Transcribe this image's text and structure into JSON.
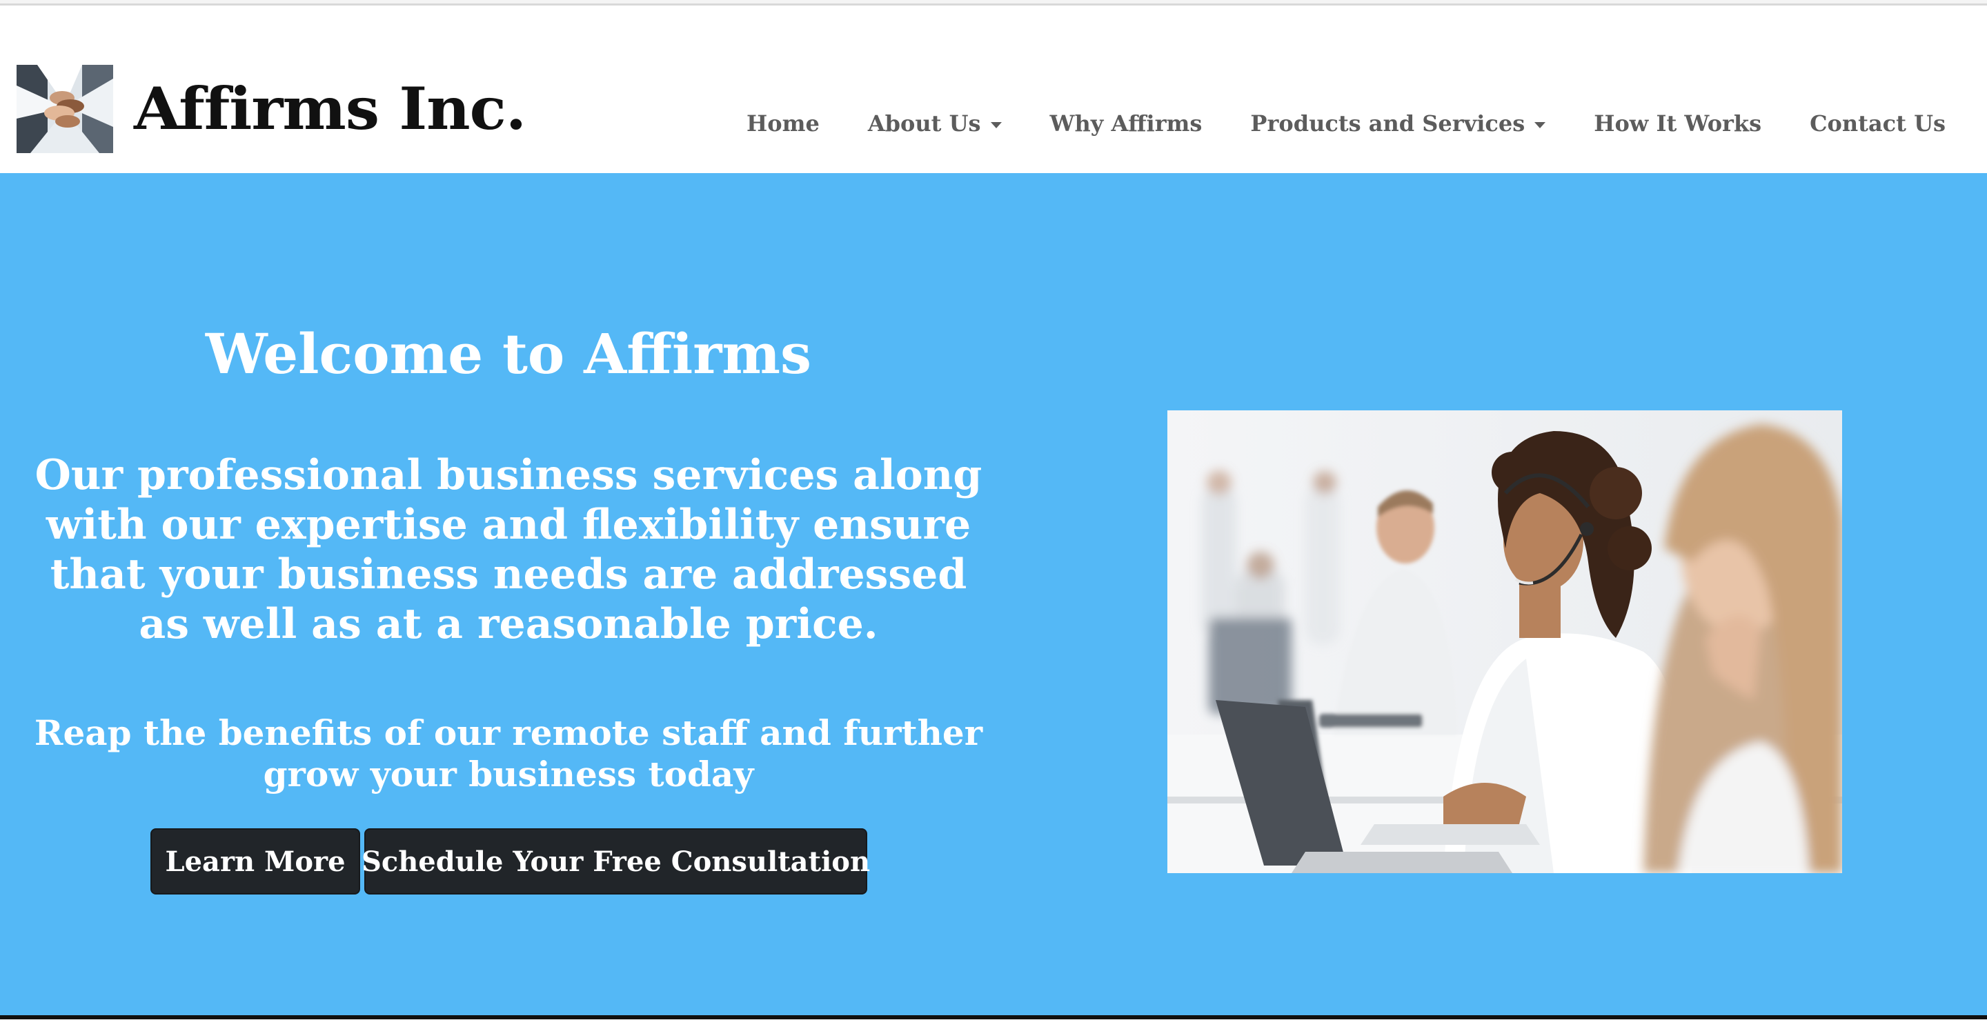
{
  "header": {
    "brand_name": "Affirms Inc.",
    "logo_icon": "team-hands-logo"
  },
  "nav": {
    "items": [
      {
        "label": "Home",
        "has_dropdown": false
      },
      {
        "label": "About Us",
        "has_dropdown": true
      },
      {
        "label": "Why Affirms",
        "has_dropdown": false
      },
      {
        "label": "Products and Services",
        "has_dropdown": true
      },
      {
        "label": "How It Works",
        "has_dropdown": false
      },
      {
        "label": "Contact Us",
        "has_dropdown": false
      }
    ]
  },
  "hero": {
    "title": "Welcome to Affirms",
    "lead": "Our professional business services along with our expertise and flexibility ensure that your business needs are addressed as well as at a reasonable price.",
    "sub": "Reap the benefits of our remote staff and further grow your business today",
    "buttons": {
      "learn_more": "Learn More",
      "schedule": "Schedule Your Free Consultation"
    }
  },
  "colors": {
    "hero_background": "#54b8f6",
    "button_background": "#212529",
    "nav_text": "#5c5c5c",
    "brand_text": "#111111"
  }
}
